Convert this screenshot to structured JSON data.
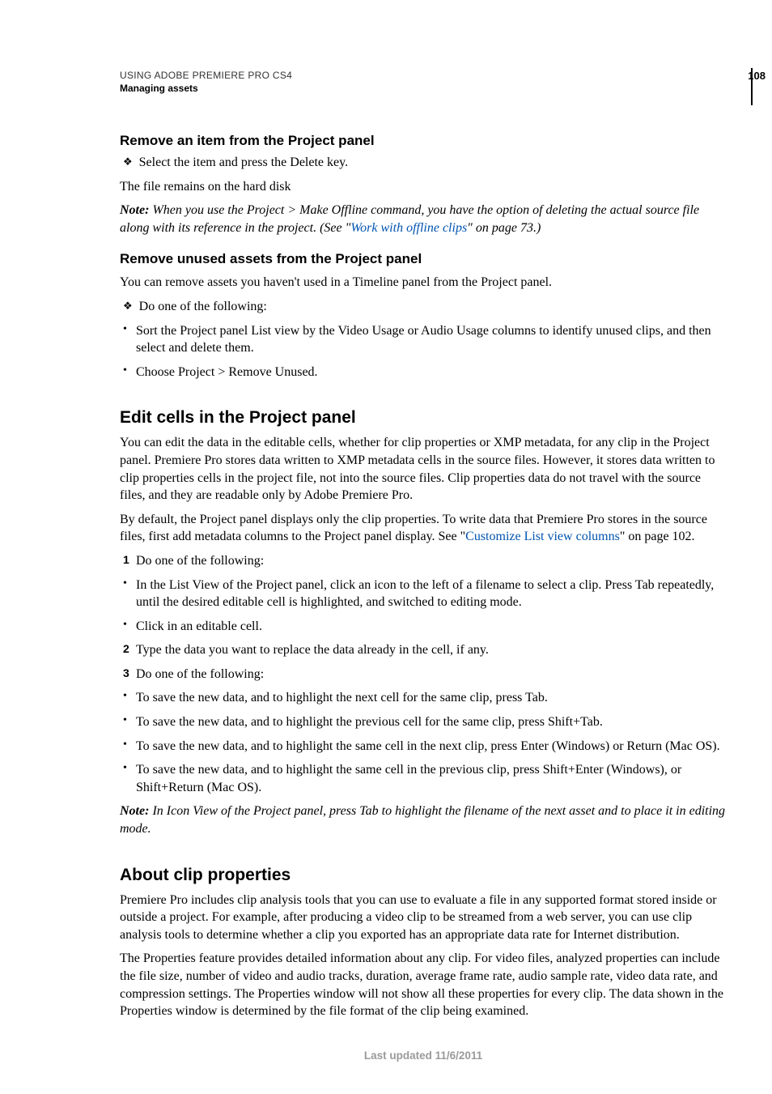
{
  "header": {
    "line1": "USING ADOBE PREMIERE PRO CS4",
    "line2": "Managing assets",
    "pagenum": "108"
  },
  "sec1": {
    "title": "Remove an item from the Project panel",
    "bullet1": "Select the item and press the Delete key.",
    "after": "The file remains on the hard disk",
    "note_label": "Note: ",
    "note_a": "When you use the Project > Make Offline command, you have the option of deleting the actual source file along with its reference in the project. (See \"",
    "note_link": "Work with offline clips",
    "note_b": "\" on page 73.)"
  },
  "sec2": {
    "title": "Remove unused assets from the Project panel",
    "intro": "You can remove assets you haven't used in a Timeline panel from the Project panel.",
    "lead": "Do one of the following:",
    "b1": "Sort the Project panel List view by the Video Usage or Audio Usage columns to identify unused clips, and then select and delete them.",
    "b2": "Choose Project > Remove Unused."
  },
  "sec3": {
    "title": "Edit cells in the Project panel",
    "p1": "You can edit the data in the editable cells, whether for clip properties or XMP metadata, for any clip in the Project panel. Premiere Pro stores data written to XMP metadata cells in the source files. However, it stores data written to clip properties cells in the project file, not into the source files. Clip properties data do not travel with the source files, and they are readable only by Adobe Premiere Pro.",
    "p2a": "By default, the Project panel displays only the clip properties. To write data that Premiere Pro stores in the source files, first add metadata columns to the Project panel display. See \"",
    "p2link": "Customize List view columns",
    "p2b": "\" on page 102.",
    "s1": "Do one of the following:",
    "s1b1": "In the List View of the Project panel, click an icon to the left of a filename to select a clip. Press Tab repeatedly, until the desired editable cell is highlighted, and switched to editing mode.",
    "s1b2": "Click in an editable cell.",
    "s2": "Type the data you want to replace the data already in the cell, if any.",
    "s3": "Do one of the following:",
    "s3b1": "To save the new data, and to highlight the next cell for the same clip, press Tab.",
    "s3b2": "To save the new data, and to highlight the previous cell for the same clip, press Shift+Tab.",
    "s3b3": "To save the new data, and to highlight the same cell in the next clip, press Enter (Windows) or Return (Mac OS).",
    "s3b4": "To save the new data, and to highlight the same cell in the previous clip, press Shift+Enter (Windows), or Shift+Return (Mac OS).",
    "note_label": "Note: ",
    "note": "In Icon View of the Project panel, press Tab to highlight the filename of the next asset and to place it in editing mode."
  },
  "sec4": {
    "title": "About clip properties",
    "p1": "Premiere Pro includes clip analysis tools that you can use to evaluate a file in any supported format stored inside or outside a project. For example, after producing a video clip to be streamed from a web server, you can use clip analysis tools to determine whether a clip you exported has an appropriate data rate for Internet distribution.",
    "p2": "The Properties feature provides detailed information about any clip. For video files, analyzed properties can include the file size, number of video and audio tracks, duration, average frame rate, audio sample rate, video data rate, and compression settings. The Properties window will not show all these properties for every clip. The data shown in the Properties window is determined by the file format of the clip being examined."
  },
  "footer": "Last updated 11/6/2011"
}
